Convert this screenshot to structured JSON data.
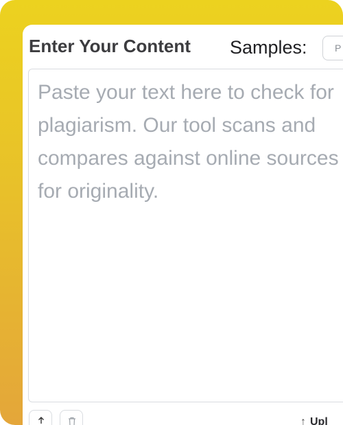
{
  "header": {
    "title": "Enter Your Content",
    "samples_label": "Samples:",
    "samples_select_value": "P"
  },
  "editor": {
    "placeholder": "Paste your text here to check for plagiarism. Our tool scans and compares against online sources for originality."
  },
  "toolbar": {
    "upload_icon": "upload-icon",
    "trash_icon": "trash-icon",
    "upload_arrow": "↑",
    "upload_label": "Upl"
  },
  "colors": {
    "gradient_top": "#ecd21f",
    "gradient_bottom": "#e4a63a",
    "placeholder_text": "#a6abb2",
    "title_text": "#3c3c3f"
  }
}
